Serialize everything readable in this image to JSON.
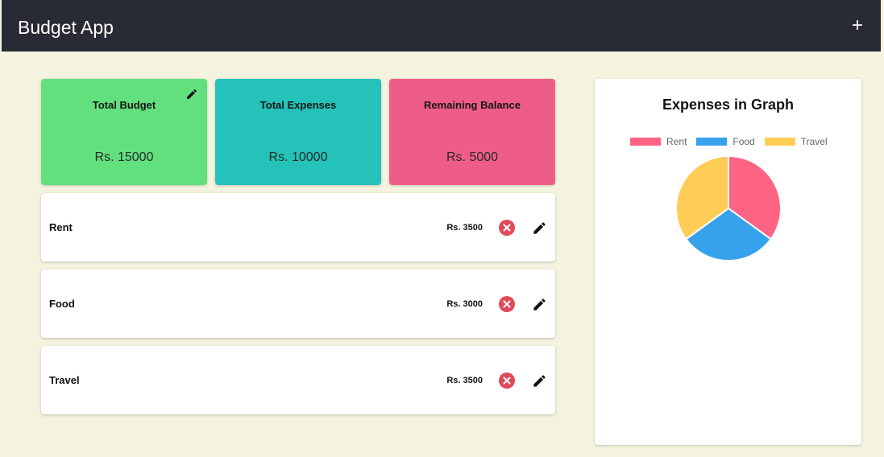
{
  "header": {
    "title": "Budget App",
    "add_label": "+"
  },
  "cards": [
    {
      "title": "Total Budget",
      "value": "Rs. 15000",
      "color": "#62e07d",
      "editable": true
    },
    {
      "title": "Total Expenses",
      "value": "Rs. 10000",
      "color": "#24c2b8",
      "editable": false
    },
    {
      "title": "Remaining Balance",
      "value": "Rs. 5000",
      "color": "#ee5d87",
      "editable": false
    }
  ],
  "expenses": [
    {
      "name": "Rent",
      "amount": "Rs. 3500"
    },
    {
      "name": "Food",
      "amount": "Rs. 3000"
    },
    {
      "name": "Travel",
      "amount": "Rs. 3500"
    }
  ],
  "icons": {
    "delete": "close-circle-icon",
    "edit": "pencil-icon"
  },
  "graph": {
    "title": "Expenses in Graph"
  },
  "chart_data": {
    "type": "pie",
    "categories": [
      "Rent",
      "Food",
      "Travel"
    ],
    "values": [
      3500,
      3000,
      3500
    ],
    "colors": [
      "#ff6384",
      "#36a2eb",
      "#ffcd56"
    ],
    "legend": "top"
  }
}
